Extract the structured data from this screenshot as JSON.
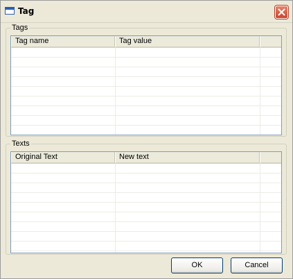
{
  "window": {
    "title": "Tag",
    "icon": "window-icon",
    "close_icon": "close-icon",
    "close_color": "#d8573b"
  },
  "tags_group": {
    "label": "Tags",
    "columns": [
      "Tag name",
      "Tag value",
      ""
    ],
    "rows": []
  },
  "texts_group": {
    "label": "Texts",
    "columns": [
      "Original Text",
      "New text",
      ""
    ],
    "rows": []
  },
  "buttons": {
    "ok_label": "OK",
    "cancel_label": "Cancel"
  }
}
